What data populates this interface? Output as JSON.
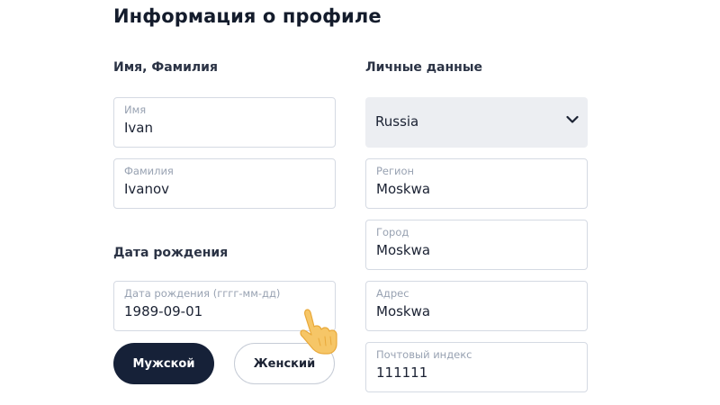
{
  "page": {
    "title": "Информация о профиле"
  },
  "name_section": {
    "heading": "Имя, Фамилия",
    "first_name": {
      "label": "Имя",
      "value": "Ivan"
    },
    "last_name": {
      "label": "Фамилия",
      "value": "Ivanov"
    }
  },
  "birth_section": {
    "heading": "Дата рождения",
    "birth_date": {
      "label": "Дата рождения (гггг-мм-дд)",
      "value": "1989-09-01"
    }
  },
  "gender": {
    "male_label": "Мужской",
    "female_label": "Женский",
    "selected": "Мужской"
  },
  "personal_section": {
    "heading": "Личные данные",
    "country": {
      "value": "Russia",
      "icon": "chevron-down-icon"
    },
    "region": {
      "label": "Регион",
      "value": "Moskwa"
    },
    "city": {
      "label": "Город",
      "value": "Moskwa"
    },
    "address": {
      "label": "Адрес",
      "value": "Moskwa"
    },
    "postal_code": {
      "label": "Почтовый индекс",
      "value": "111111"
    }
  },
  "colors": {
    "primary_dark": "#162138",
    "field_border": "#d5dae3",
    "select_bg": "#eceef2",
    "label_gray": "#98a2b2",
    "cursor_fill": "#f6c667"
  },
  "cursor": {
    "icon": "hand-pointer-icon"
  }
}
